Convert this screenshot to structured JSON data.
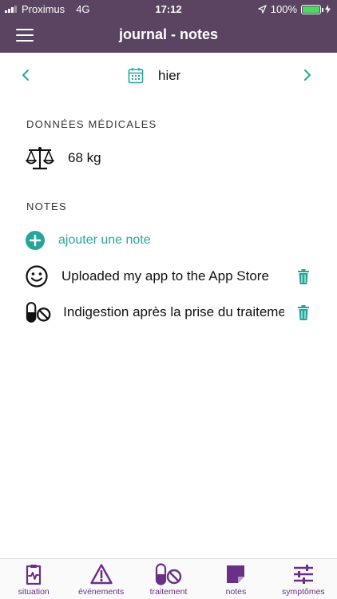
{
  "status_bar": {
    "carrier": "Proximus",
    "network": "4G",
    "time": "17:12",
    "battery": "100%"
  },
  "header": {
    "title": "journal - notes"
  },
  "date_nav": {
    "label": "hier"
  },
  "medical": {
    "section_title": "DONNÉES MÉDICALES",
    "weight": "68 kg"
  },
  "notes": {
    "section_title": "NOTES",
    "add_label": "ajouter une note",
    "items": [
      {
        "icon": "smiley-icon",
        "text": "Uploaded my app to the App Store"
      },
      {
        "icon": "pill-stop-icon",
        "text": "Indigestion après la prise du traitement"
      }
    ]
  },
  "tabs": [
    {
      "icon": "clipboard-pulse-icon",
      "label": "situation"
    },
    {
      "icon": "warning-icon",
      "label": "événements"
    },
    {
      "icon": "pill-stop-icon",
      "label": "traitement"
    },
    {
      "icon": "note-icon",
      "label": "notes"
    },
    {
      "icon": "sliders-icon",
      "label": "symptômes"
    }
  ],
  "colors": {
    "header_bg": "#5b4462",
    "accent": "#26a69a",
    "tab_color": "#6a2f86"
  }
}
